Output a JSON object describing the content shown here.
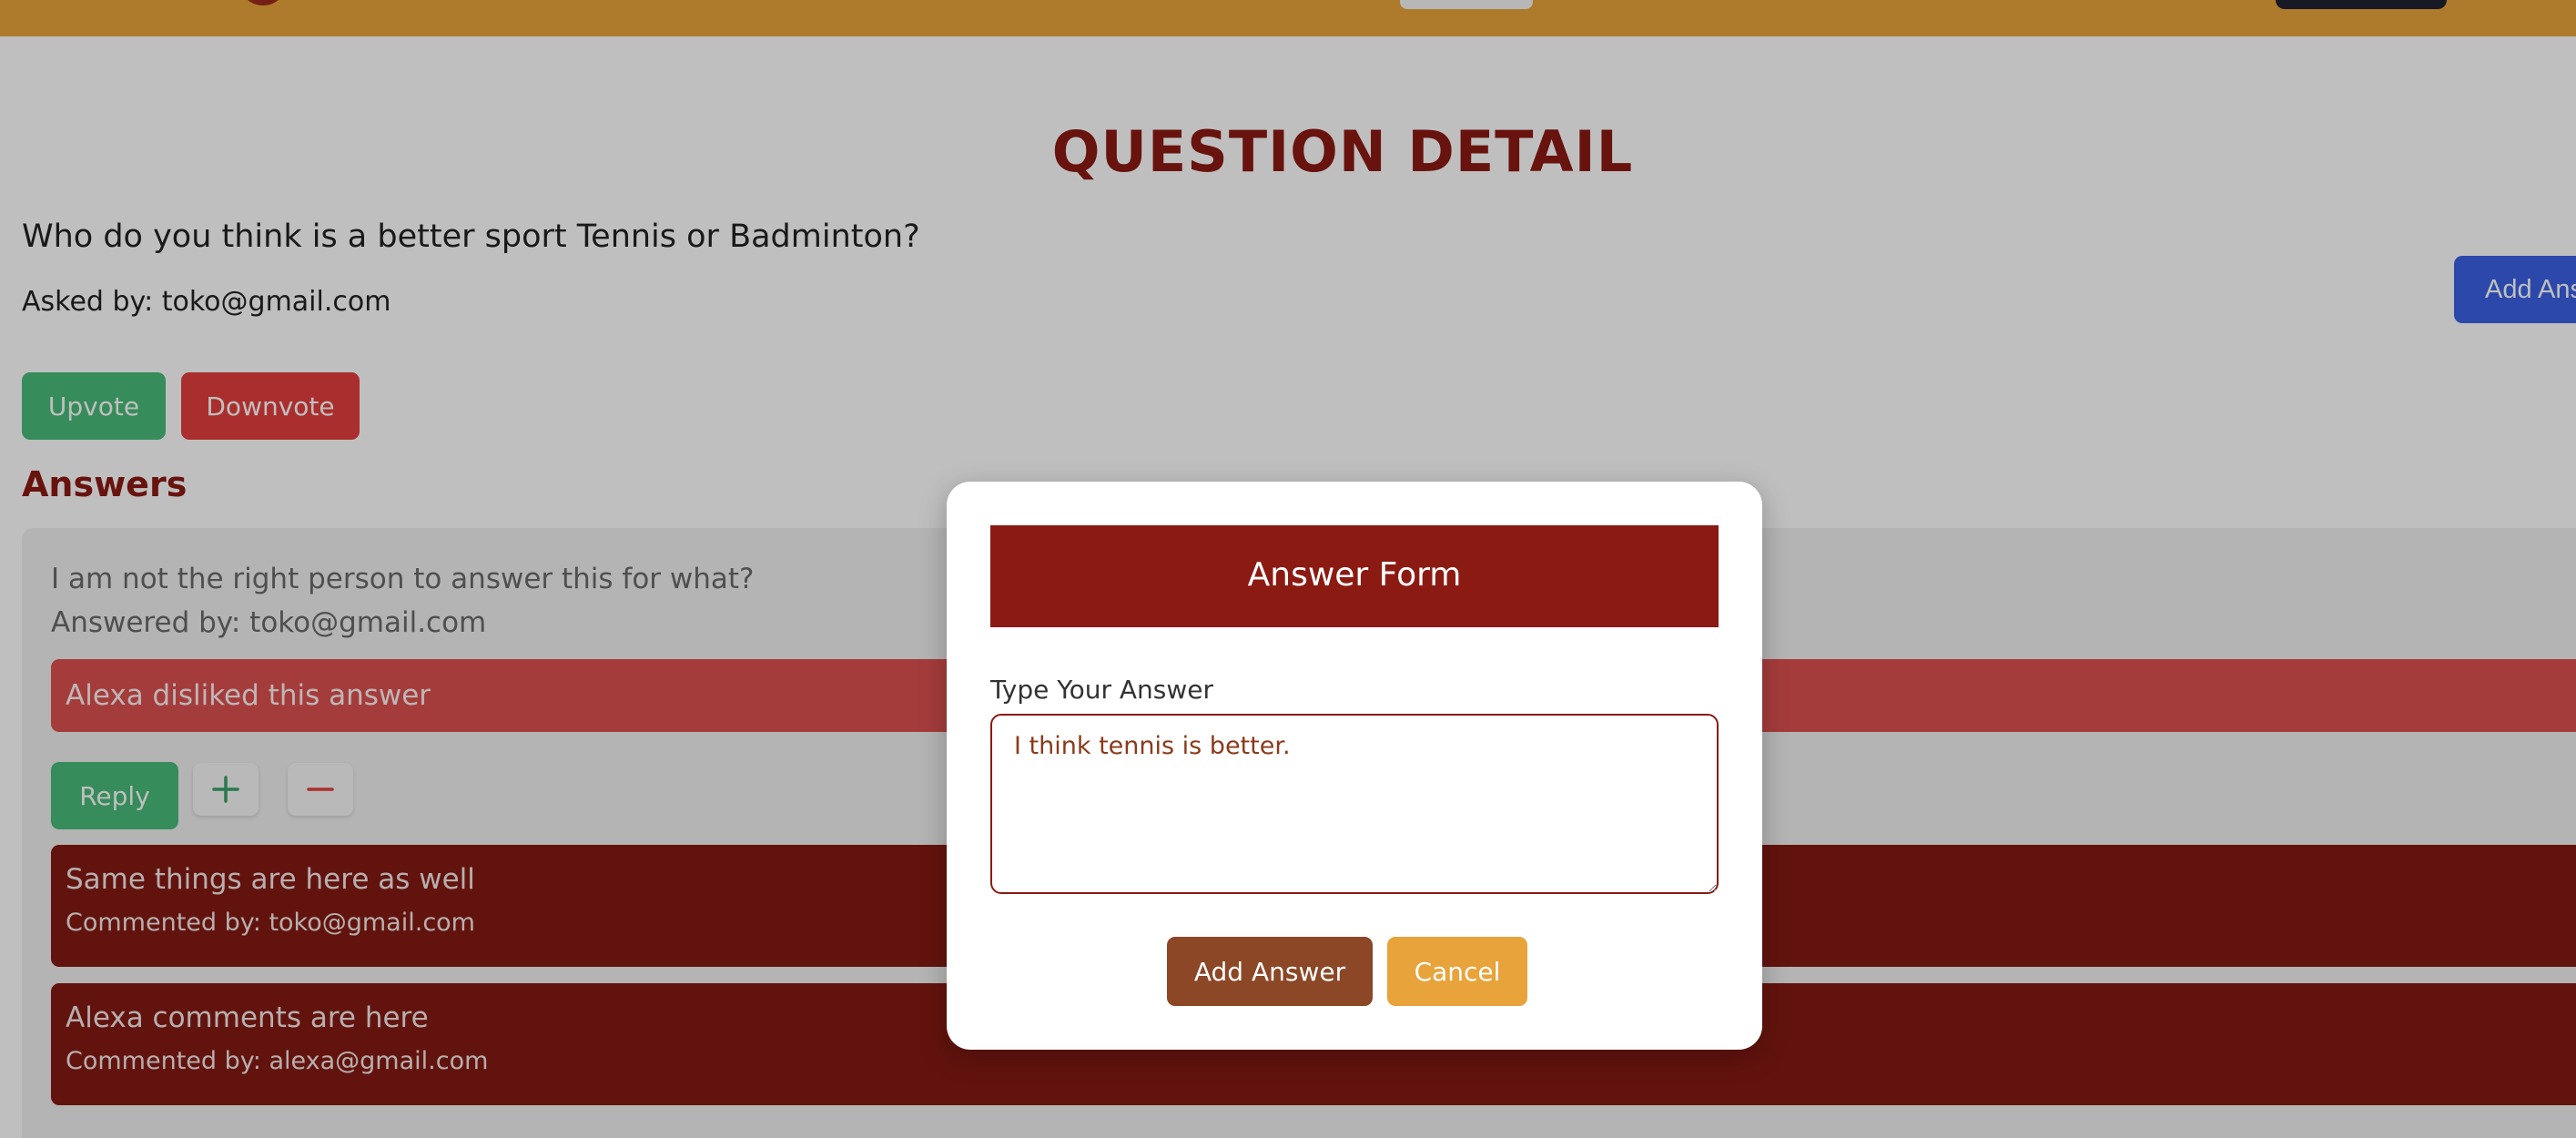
{
  "colors": {
    "navbar": "#e8a33a",
    "brand_red": "#8b1a13",
    "upvote_green": "#48bb78",
    "downvote_red": "#e53e3e",
    "primary_blue": "#3b60e4",
    "cancel_orange": "#e8a33a",
    "add_answer_brown": "#8b4726"
  },
  "page": {
    "title": "QUESTION DETAIL",
    "question": "Who do you think is a better sport Tennis or Badminton?",
    "asked_by": "Asked by: toko@gmail.com",
    "add_answer_label": "Add Answer",
    "upvote_label": "Upvote",
    "downvote_label": "Downvote",
    "answers_heading": "Answers"
  },
  "answers": [
    {
      "text": "I am not the right person to answer this for what?",
      "answered_by": "Answered by: toko@gmail.com",
      "reaction": "Alexa disliked this answer",
      "reply_label": "Reply",
      "plus_icon": "plus-icon",
      "minus_icon": "minus-icon",
      "comments": [
        {
          "text": "Same things are here as well",
          "by": "Commented by: toko@gmail.com"
        },
        {
          "text": "Alexa comments are here",
          "by": "Commented by: alexa@gmail.com"
        }
      ]
    }
  ],
  "modal": {
    "title": "Answer Form",
    "field_label": "Type Your Answer",
    "answer_value": "I think tennis is better.",
    "add_label": "Add Answer",
    "cancel_label": "Cancel"
  }
}
